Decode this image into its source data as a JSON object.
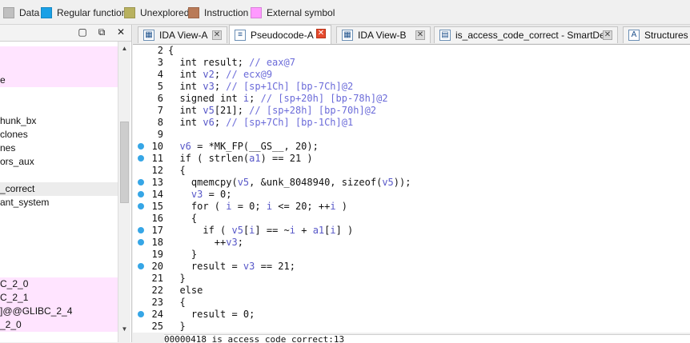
{
  "legend": {
    "items": [
      {
        "label": "Data",
        "color": "#c0c0c0"
      },
      {
        "label": "Regular function",
        "color": "#1aa0e6"
      },
      {
        "label": "Unexplored",
        "color": "#b8b15f"
      },
      {
        "label": "Instruction",
        "color": "#b97a57"
      },
      {
        "label": "External symbol",
        "color": "#ff99ff"
      }
    ]
  },
  "left_pane": {
    "rows": [
      {
        "text": "",
        "hl": "pink"
      },
      {
        "text": "",
        "hl": "pink"
      },
      {
        "text": "e",
        "hl": "pink"
      },
      {
        "text": "",
        "hl": ""
      },
      {
        "text": "",
        "hl": ""
      },
      {
        "text": "hunk_bx",
        "hl": ""
      },
      {
        "text": "clones",
        "hl": ""
      },
      {
        "text": "nes",
        "hl": ""
      },
      {
        "text": "ors_aux",
        "hl": ""
      },
      {
        "text": "",
        "hl": ""
      },
      {
        "text": "_correct",
        "hl": "grey"
      },
      {
        "text": "ant_system",
        "hl": ""
      },
      {
        "text": "",
        "hl": ""
      },
      {
        "text": "",
        "hl": ""
      },
      {
        "text": "",
        "hl": ""
      },
      {
        "text": "",
        "hl": ""
      },
      {
        "text": "",
        "hl": ""
      },
      {
        "text": "C_2_0",
        "hl": "pink"
      },
      {
        "text": "C_2_1",
        "hl": "pink"
      },
      {
        "text": "]@@GLIBC_2_4",
        "hl": "pink"
      },
      {
        "text": "_2_0",
        "hl": "pink"
      }
    ]
  },
  "tabs": [
    {
      "label": "IDA View-A",
      "icon": "ida-view-icon",
      "active": false
    },
    {
      "label": "Pseudocode-A",
      "icon": "pseudocode-icon",
      "active": true
    },
    {
      "label": "IDA View-B",
      "icon": "ida-view-icon",
      "active": false
    },
    {
      "label": "is_access_code_correct - SmartDec",
      "icon": "smartdec-icon",
      "active": false
    },
    {
      "label": "Structures",
      "icon": "structures-icon",
      "active": false
    }
  ],
  "code_lines": [
    {
      "num": "2",
      "dot": false,
      "text": "{"
    },
    {
      "num": "3",
      "dot": false,
      "text": "  int result; // eax@7"
    },
    {
      "num": "4",
      "dot": false,
      "text": "  int v2; // ecx@9"
    },
    {
      "num": "5",
      "dot": false,
      "text": "  int v3; // [sp+1Ch] [bp-7Ch]@2"
    },
    {
      "num": "6",
      "dot": false,
      "text": "  signed int i; // [sp+20h] [bp-78h]@2"
    },
    {
      "num": "7",
      "dot": false,
      "text": "  int v5[21]; // [sp+28h] [bp-70h]@2"
    },
    {
      "num": "8",
      "dot": false,
      "text": "  int v6; // [sp+7Ch] [bp-1Ch]@1"
    },
    {
      "num": "9",
      "dot": false,
      "text": ""
    },
    {
      "num": "10",
      "dot": true,
      "text": "  v6 = *MK_FP(__GS__, 20);"
    },
    {
      "num": "11",
      "dot": true,
      "text": "  if ( strlen(a1) == 21 )"
    },
    {
      "num": "12",
      "dot": false,
      "text": "  {"
    },
    {
      "num": "13",
      "dot": true,
      "text": "    qmemcpy(v5, &unk_8048940, sizeof(v5));"
    },
    {
      "num": "14",
      "dot": true,
      "text": "    v3 = 0;"
    },
    {
      "num": "15",
      "dot": true,
      "text": "    for ( i = 0; i <= 20; ++i )"
    },
    {
      "num": "16",
      "dot": false,
      "text": "    {"
    },
    {
      "num": "17",
      "dot": true,
      "text": "      if ( v5[i] == ~i + a1[i] )"
    },
    {
      "num": "18",
      "dot": true,
      "text": "        ++v3;"
    },
    {
      "num": "19",
      "dot": false,
      "text": "    }"
    },
    {
      "num": "20",
      "dot": true,
      "text": "    result = v3 == 21;"
    },
    {
      "num": "21",
      "dot": false,
      "text": "  }"
    },
    {
      "num": "22",
      "dot": false,
      "text": "  else"
    },
    {
      "num": "23",
      "dot": false,
      "text": "  {"
    },
    {
      "num": "24",
      "dot": true,
      "text": "    result = 0;"
    },
    {
      "num": "25",
      "dot": false,
      "text": "  }"
    }
  ],
  "status": "00000418 is_access_code_correct:13"
}
